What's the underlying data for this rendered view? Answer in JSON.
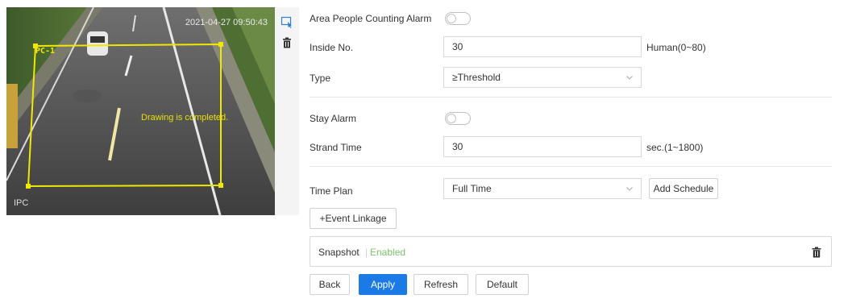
{
  "preview": {
    "timestamp": "2021-04-27 09:50:43",
    "channel_label": "IPC",
    "rule_tag": "PC-1",
    "drawing_status": "Drawing is completed."
  },
  "tools": {
    "draw_icon": "draw-area-icon",
    "delete_icon": "trash-icon"
  },
  "form": {
    "area_alarm": {
      "label": "Area People Counting Alarm",
      "enabled": false
    },
    "inside_no": {
      "label": "Inside No.",
      "value": "30",
      "unit": "Human(0~80)"
    },
    "type": {
      "label": "Type",
      "value": "≥Threshold"
    },
    "stay_alarm": {
      "label": "Stay Alarm",
      "enabled": false
    },
    "strand_time": {
      "label": "Strand Time",
      "value": "30",
      "unit": "sec.(1~1800)"
    },
    "time_plan": {
      "label": "Time Plan",
      "value": "Full Time",
      "add_schedule": "Add Schedule"
    },
    "event_linkage": "+Event Linkage",
    "snapshot": {
      "label": "Snapshot",
      "separator": "|",
      "status": "Enabled"
    }
  },
  "actions": {
    "back": "Back",
    "apply": "Apply",
    "refresh": "Refresh",
    "default": "Default"
  },
  "colors": {
    "accent": "#1b7ae6",
    "rule_box": "#f0e800",
    "enabled_text": "#7cc36a"
  }
}
